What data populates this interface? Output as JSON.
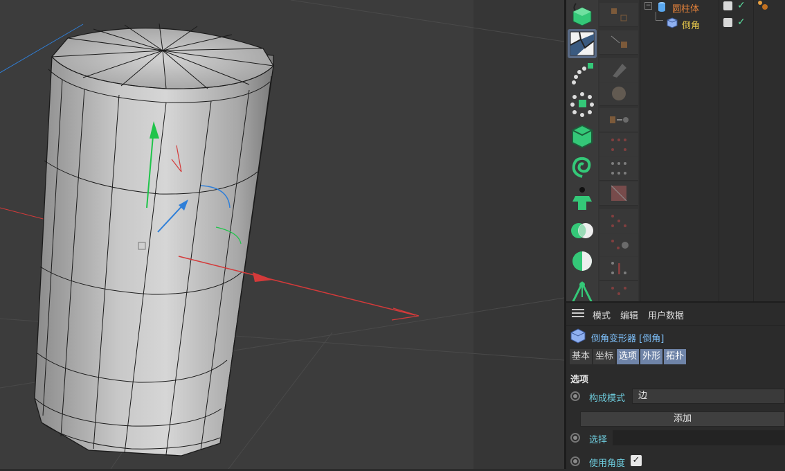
{
  "colors": {
    "viewport_bg": "#3c3c3c",
    "axis_x": "#d43a3a",
    "axis_y": "#1fc44a",
    "axis_z": "#2f7fd8",
    "tool_green": "#34c878",
    "object_orange": "#e8833a",
    "object_yellow": "#e8c94b",
    "label_cyan": "#6fcfe0",
    "title_blue": "#7fc3ff",
    "tab_active": "#6f84a8"
  },
  "toolbar": {
    "tools": [
      {
        "icon": "cube-primitive-icon"
      },
      {
        "icon": "polygon-mesh-icon",
        "active": true
      },
      {
        "icon": "spline-array-icon"
      },
      {
        "icon": "cloner-icon"
      },
      {
        "icon": "deformer-cube-icon"
      },
      {
        "icon": "spiral-effector-icon"
      },
      {
        "icon": "character-icon"
      },
      {
        "icon": "boole-icon"
      },
      {
        "icon": "sphere-shade-icon"
      },
      {
        "icon": "camera-target-icon"
      }
    ]
  },
  "subtools": [
    {
      "icon": "move-tool-icon"
    },
    {
      "icon": "point-tool-icon"
    },
    {
      "icon": "edge-tool-icon"
    },
    {
      "icon": "sphere-tool-icon"
    },
    {
      "icon": "arrow-tool-icon"
    },
    {
      "icon": "points-grid-icon"
    },
    {
      "icon": "dots-grid-icon"
    },
    {
      "icon": "texture-icon"
    },
    {
      "icon": "dots-grid-2-icon"
    },
    {
      "icon": "dots-gear-icon"
    },
    {
      "icon": "dots-arrow-icon"
    },
    {
      "icon": "dots-cross-icon"
    }
  ],
  "object_manager": {
    "objects": [
      {
        "name": "圆柱体",
        "icon": "cylinder-icon",
        "color": "#e8833a",
        "level": 0
      },
      {
        "name": "倒角",
        "icon": "bevel-deformer-icon",
        "color": "#e8c94b",
        "level": 1
      }
    ]
  },
  "attribute_manager": {
    "menu": [
      "模式",
      "编辑",
      "用户数据"
    ],
    "title": "倒角变形器 [倒角]",
    "tabs": [
      {
        "label": "基本",
        "active": false
      },
      {
        "label": "坐标",
        "active": false
      },
      {
        "label": "选项",
        "active": true
      },
      {
        "label": "外形",
        "active": true
      },
      {
        "label": "拓扑",
        "active": true
      }
    ],
    "section": "选项",
    "fields": {
      "mode_label": "构成模式",
      "mode_value": "边",
      "add_button": "添加",
      "selection_label": "选择",
      "selection_value": "",
      "use_angle_label": "使用角度",
      "use_angle_checked": "✓"
    }
  }
}
